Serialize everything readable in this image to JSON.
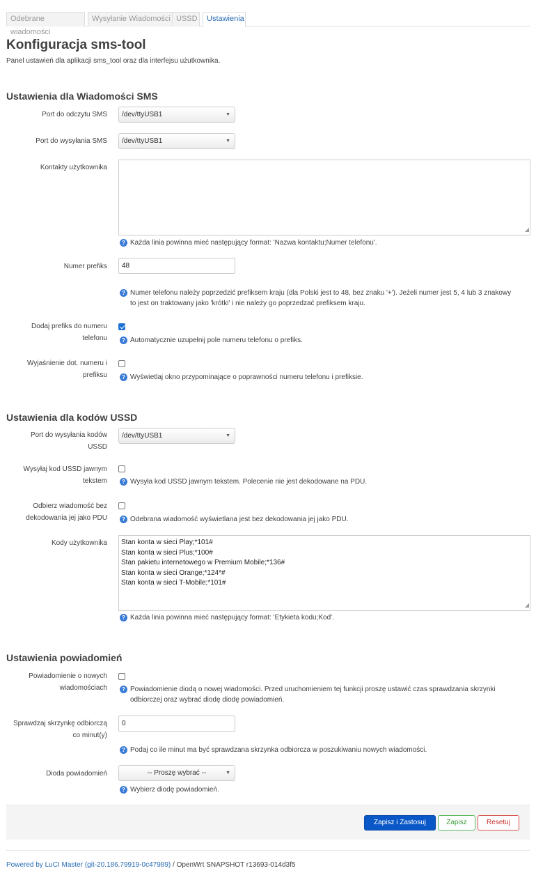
{
  "tabs": [
    {
      "label": "Odebrane wiadomości"
    },
    {
      "label": "Wysyłanie Wiadomości"
    },
    {
      "label": "USSD"
    },
    {
      "label": "Ustawienia"
    }
  ],
  "page": {
    "title": "Konfiguracja sms-tool",
    "subtitle": "Panel ustawień dla aplikacji sms_tool oraz dla interfejsu użutkownika."
  },
  "sms": {
    "heading": "Ustawienia dla Wiadomości SMS",
    "read_port": {
      "label": "Port do odczytu SMS",
      "value": "/dev/ttyUSB1"
    },
    "send_port": {
      "label": "Port do wysyłania SMS",
      "value": "/dev/ttyUSB1"
    },
    "contacts": {
      "label": "Kontakty użytkownika",
      "value": "",
      "help": "Każda linia powinna mieć następujący format: 'Nazwa kontaktu;Numer telefonu'."
    },
    "prefix": {
      "label": "Numer prefiks",
      "value": "48",
      "help_line1": "Numer telefonu należy poprzedzić prefiksem kraju (dla Polski jest to 48, bez znaku '+'). Jeżeli numer jest 5, 4 lub 3 znakowy",
      "help_line2": "to jest on traktowany jako 'krótki' i nie należy go poprzedzać prefiksem kraju."
    },
    "add_prefix": {
      "label_line1": "Dodaj prefiks do numeru",
      "label_line2": "telefonu",
      "checked": true,
      "help": "Automatycznie uzupełnij pole numeru telefonu o prefiks."
    },
    "explain": {
      "label_line1": "Wyjaśnienie dot. numeru i",
      "label_line2": "prefiksu",
      "checked": false,
      "help": "Wyświetlaj okno przypominające o poprawności numeru telefonu i prefiksie."
    }
  },
  "ussd": {
    "heading": "Ustawienia dla kodów USSD",
    "port": {
      "label_line1": "Port do wysyłania kodów",
      "label_line2": "USSD",
      "value": "/dev/ttyUSB1"
    },
    "plain": {
      "label_line1": "Wysyłaj kod USSD jawnym",
      "label_line2": "tekstem",
      "checked": false,
      "help": "Wysyła kod USSD jawnym tekstem. Polecenie nie jest dekodowane na PDU."
    },
    "no_decode": {
      "label_line1": "Odbierz wiadomość bez",
      "label_line2": "dekodowania jej jako PDU",
      "checked": false,
      "help": "Odebrana wiadomość wyświetlana jest bez dekodowania jej jako PDU."
    },
    "codes": {
      "label": "Kody użytkownika",
      "lines": [
        "Stan konta w sieci Play;*101#",
        "Stan konta w sieci Plus;*100#",
        "Stan pakietu internetowego w Premium Mobile;*136#",
        "Stan konta w sieci Orange;*124*#",
        "Stan konta w sieci T-Mobile;*101#"
      ],
      "help": "Każda linia powinna mieć następujący format: 'Etykieta kodu;Kod'."
    }
  },
  "notify": {
    "heading": "Ustawienia powiadomień",
    "new_msg": {
      "label_line1": "Powiadomienie o nowych",
      "label_line2": "wiadomościach",
      "checked": false,
      "help_line1": "Powiadomienie diodą o nowej wiadomości. Przed uruchomieniem tej funkcji proszę ustawić czas sprawdzania skrzynki",
      "help_line2": "odbiorczej oraz wybrać diodę diodę powiadomień."
    },
    "interval": {
      "label_line1": "Sprawdzaj skrzynkę odbiorczą",
      "label_line2": "co minut(y)",
      "value": "0",
      "help": "Podaj co ile minut ma być sprawdzana skrzynka odbiorcza w poszukiwaniu nowych wiadomości."
    },
    "led": {
      "label": "Dioda powiadomień",
      "value": "-- Proszę wybrać --",
      "help": "Wybierz diodę powiadomień."
    }
  },
  "actions": {
    "apply": "Zapisz i Zastosuj",
    "save": "Zapisz",
    "reset": "Resetuj"
  },
  "footer": {
    "link": "Powered by LuCI Master (git-20.186.79919-0c47989)",
    "text": " / OpenWrt SNAPSHOT r13693-014d3f5"
  }
}
